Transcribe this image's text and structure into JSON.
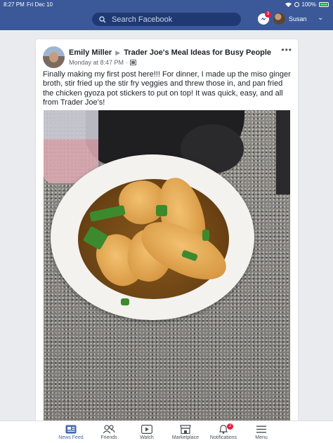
{
  "status_bar": {
    "time": "8:27 PM",
    "date": "Fri Dec 10",
    "battery": "100%"
  },
  "header": {
    "search_placeholder": "Search Facebook",
    "messenger_badge": "3",
    "user_name": "Susan"
  },
  "post": {
    "author": "Emily Miller",
    "group": "Trader Joe's Meal Ideas for Busy People",
    "timestamp": "Monday at 8:47 PM",
    "text": "Finally making my first post here!!! For dinner, I made up the miso ginger broth, stir fried up the stir fry veggies and threw those in, and pan fried the chicken gyoza pot stickers to put on top! It was quick, easy, and all from Trader Joe's!"
  },
  "tabbar": {
    "items": [
      {
        "label": "News Feed",
        "icon": "news-feed-icon",
        "active": true
      },
      {
        "label": "Friends",
        "icon": "friends-icon"
      },
      {
        "label": "Watch",
        "icon": "watch-icon"
      },
      {
        "label": "Marketplace",
        "icon": "marketplace-icon"
      },
      {
        "label": "Notifications",
        "icon": "bell-icon",
        "badge": "2"
      },
      {
        "label": "Menu",
        "icon": "menu-icon"
      }
    ]
  },
  "colors": {
    "brand": "#3b5998",
    "accent": "#4267b2",
    "badge": "#e41e3f"
  }
}
